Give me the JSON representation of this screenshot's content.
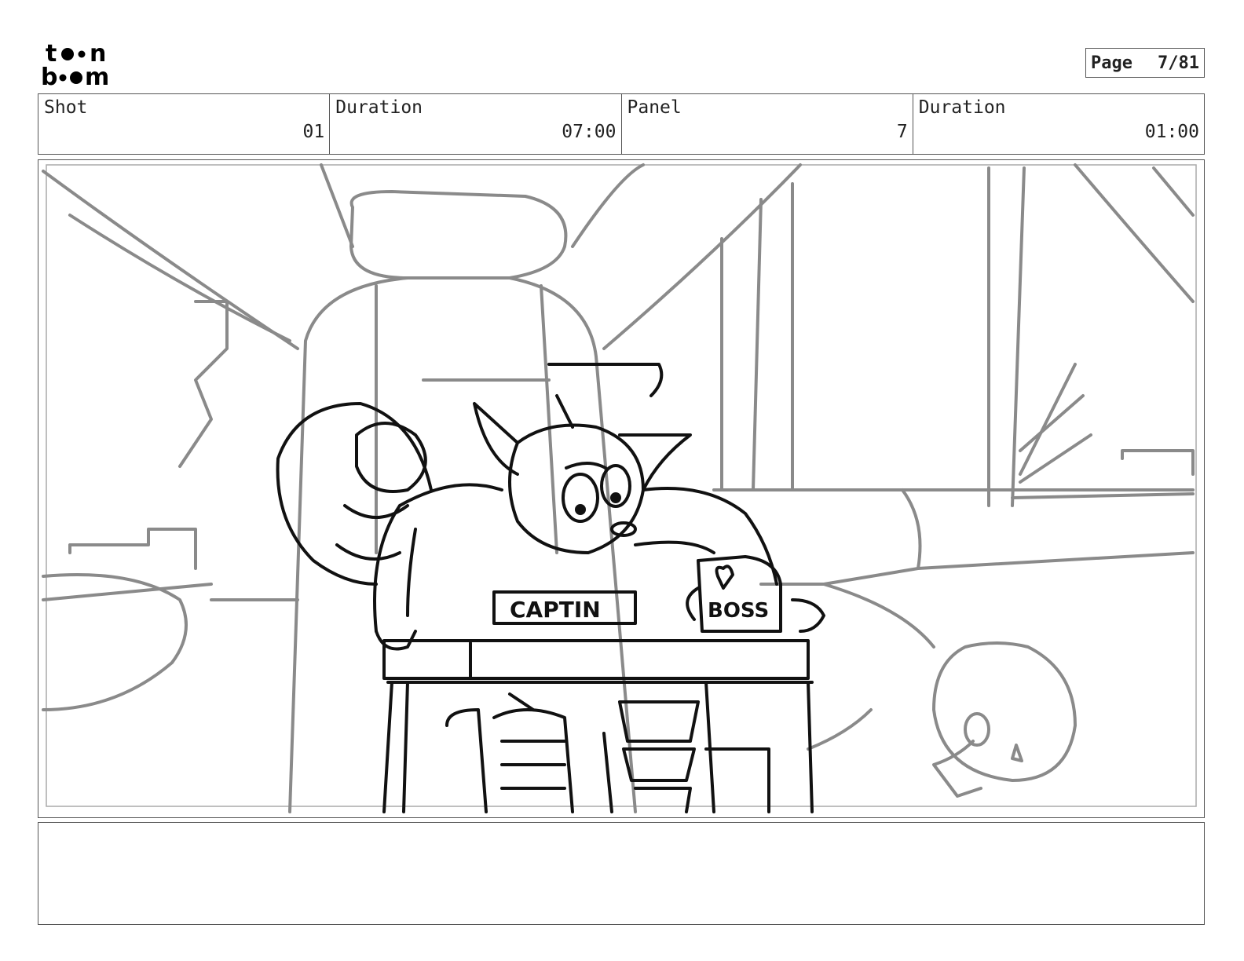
{
  "header": {
    "logo_text": "toon boom",
    "page_label": "Page",
    "page_value": "7/81"
  },
  "info": {
    "shot_label": "Shot",
    "shot_value": "01",
    "shot_duration_label": "Duration",
    "shot_duration_value": "07:00",
    "panel_label": "Panel",
    "panel_value": "7",
    "panel_duration_label": "Duration",
    "panel_duration_value": "01:00"
  },
  "panel": {
    "sign_text": "CAPTIN",
    "mug_text": "BOSS"
  },
  "notes": {
    "text": ""
  }
}
